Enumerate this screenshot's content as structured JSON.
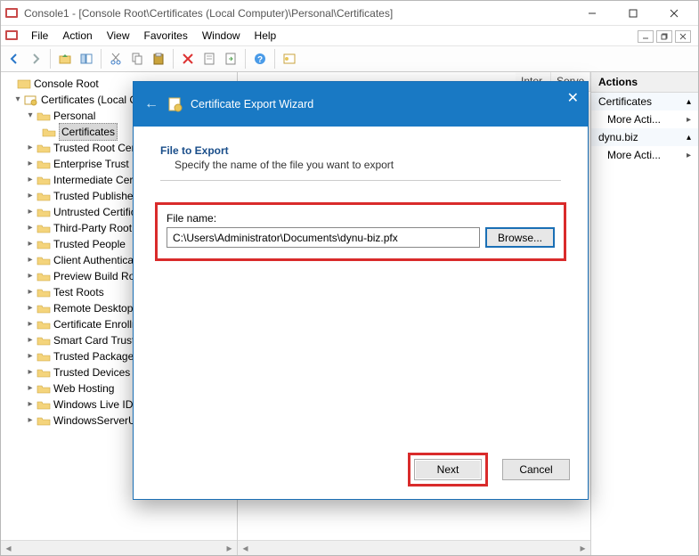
{
  "window": {
    "title": "Console1 - [Console Root\\Certificates (Local Computer)\\Personal\\Certificates]"
  },
  "menu": {
    "file": "File",
    "action": "Action",
    "view": "View",
    "favorites": "Favorites",
    "window": "Window",
    "help": "Help"
  },
  "tree": {
    "root": "Console Root",
    "certs": "Certificates (Local Com",
    "personal": "Personal",
    "certificates": "Certificates",
    "items": [
      "Trusted Root Certific",
      "Enterprise Trust",
      "Intermediate Certifi",
      "Trusted Publishers",
      "Untrusted Certificat",
      "Third-Party Root C",
      "Trusted People",
      "Client Authenticatio",
      "Preview Build Roots",
      "Test Roots",
      "Remote Desktop",
      "Certificate Enrollm",
      "Smart Card Trusted",
      "Trusted Packaged A",
      "Trusted Devices",
      "Web Hosting",
      "Windows Live ID To",
      "WindowsServerUpd"
    ]
  },
  "listcols": {
    "c0": "Inter",
    "c1": "Serve"
  },
  "actions": {
    "header": "Actions",
    "group1": "Certificates",
    "more1": "More Acti...",
    "group2": "dynu.biz",
    "more2": "More Acti..."
  },
  "wizard": {
    "title": "Certificate Export Wizard",
    "heading": "File to Export",
    "sub": "Specify the name of the file you want to export",
    "filename_label": "File name:",
    "filename_value": "C:\\Users\\Administrator\\Documents\\dynu-biz.pfx",
    "browse": "Browse...",
    "next": "Next",
    "cancel": "Cancel"
  }
}
